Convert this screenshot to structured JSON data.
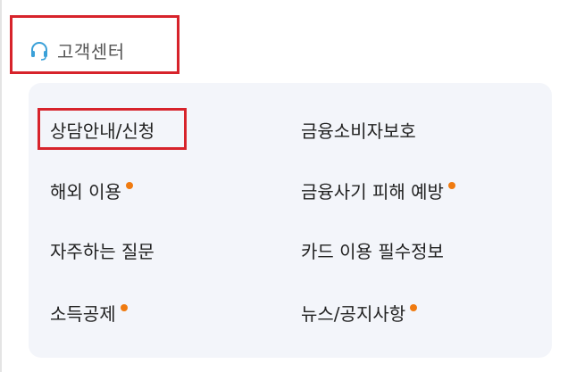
{
  "header": {
    "title": "고객센터",
    "icon": "headset-icon"
  },
  "menu": {
    "left": [
      {
        "label": "상담안내/신청",
        "new": false
      },
      {
        "label": "해외 이용",
        "new": true
      },
      {
        "label": "자주하는 질문",
        "new": false
      },
      {
        "label": "소득공제",
        "new": true
      }
    ],
    "right": [
      {
        "label": "금융소비자보호",
        "new": false
      },
      {
        "label": "금융사기 피해 예방",
        "new": true
      },
      {
        "label": "카드 이용 필수정보",
        "new": false
      },
      {
        "label": "뉴스/공지사항",
        "new": true
      }
    ]
  },
  "colors": {
    "highlight": "#d7232b",
    "dot": "#f07b10",
    "card_bg": "#f3f5fa",
    "icon": "#3aa0d8"
  }
}
